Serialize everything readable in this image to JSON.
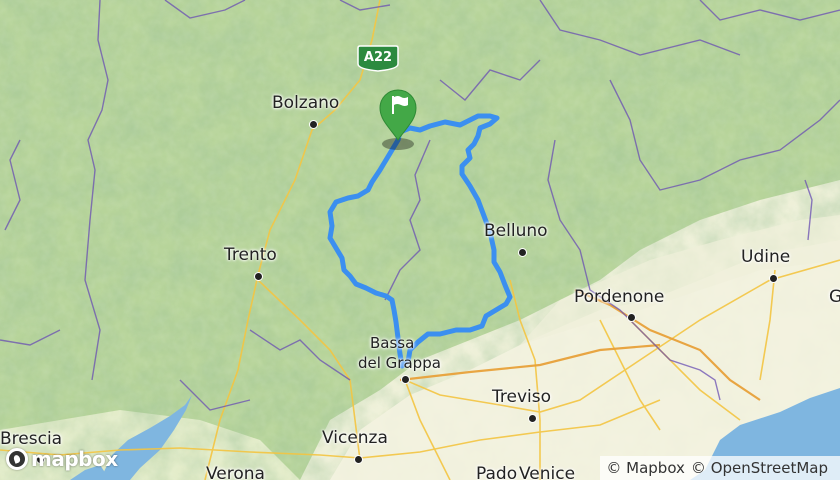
{
  "map": {
    "highway_label": "A22",
    "cities": [
      {
        "key": "bolzano",
        "name": "Bolzano"
      },
      {
        "key": "trento",
        "name": "Trento"
      },
      {
        "key": "belluno",
        "name": "Belluno"
      },
      {
        "key": "udine",
        "name": "Udine"
      },
      {
        "key": "pordenone",
        "name": "Pordenone"
      },
      {
        "key": "bassano",
        "name": "Bassano del Grappa"
      },
      {
        "key": "treviso",
        "name": "Treviso"
      },
      {
        "key": "vicenza",
        "name": "Vicenza"
      },
      {
        "key": "brescia",
        "name": "Brescia"
      },
      {
        "key": "verona",
        "name": "Verona"
      },
      {
        "key": "venice",
        "name": "Venice"
      },
      {
        "key": "padova",
        "name": "Padova"
      }
    ],
    "labels": {
      "bolzano": "Bolzano",
      "trento": "Trento",
      "belluno": "Belluno",
      "udine": "Udine",
      "pordenone": "Pordenone",
      "bassano_line1": "Bassa",
      "bassano_line2": "del Grappa",
      "treviso": "Treviso",
      "vicenza": "Vicenza",
      "brescia": "Brescia",
      "verona": "Verona",
      "venice": "Venice",
      "padova": "Pado",
      "edge_g": "G"
    },
    "route_color": "#3b8ff0",
    "start_marker": {
      "icon": "flag-icon",
      "color": "#43a847"
    },
    "logo_text": "mapbox",
    "attribution": {
      "mapbox": "© Mapbox",
      "osm": "© OpenStreetMap"
    }
  }
}
